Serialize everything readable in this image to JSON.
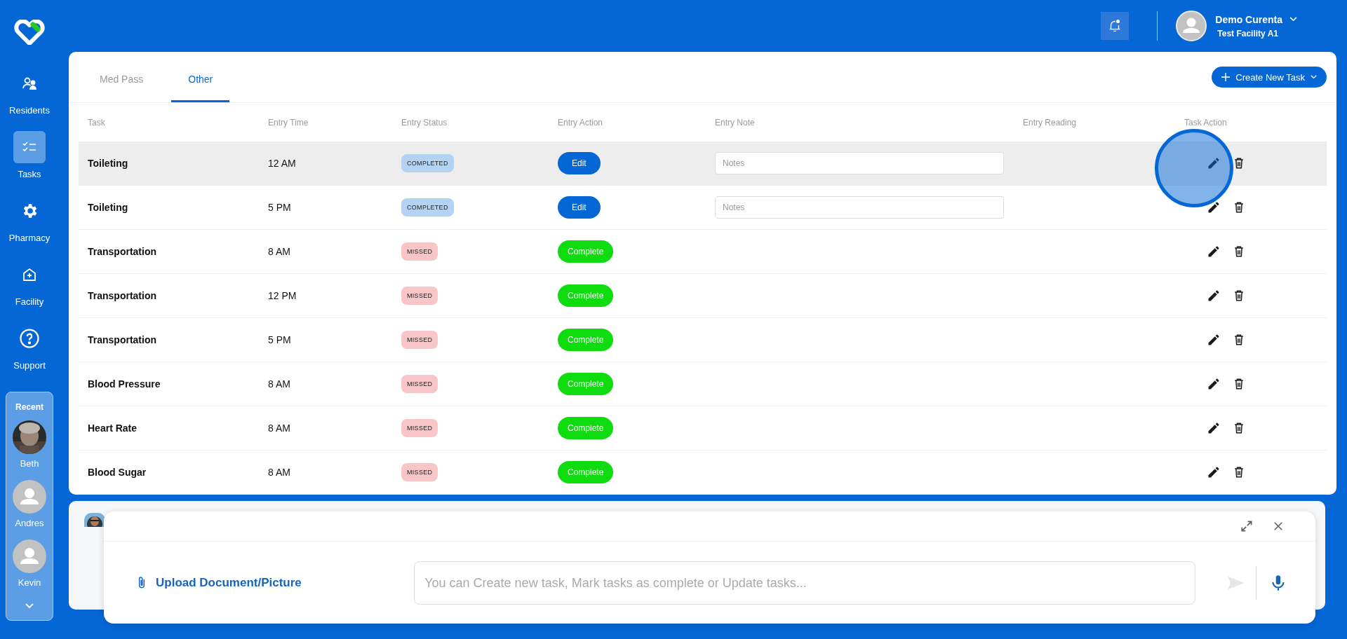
{
  "sidebar": {
    "items": [
      {
        "label": "Residents",
        "selected": false
      },
      {
        "label": "Tasks",
        "selected": true
      },
      {
        "label": "Pharmacy",
        "selected": false
      },
      {
        "label": "Facility",
        "selected": false
      },
      {
        "label": "Support",
        "selected": false
      }
    ],
    "recent": {
      "title": "Recent",
      "people": [
        {
          "name": "Beth",
          "kind": "picture"
        },
        {
          "name": "Andres",
          "kind": "default"
        },
        {
          "name": "Kevin",
          "kind": "default"
        }
      ]
    }
  },
  "header": {
    "user_name": "Demo Curenta",
    "facility": "Test Facility A1"
  },
  "tabs": [
    {
      "label": "Med Pass",
      "selected": false
    },
    {
      "label": "Other",
      "selected": true
    }
  ],
  "create_button": "Create New Task",
  "table": {
    "columns": [
      "Task",
      "Entry Time",
      "Entry Status",
      "Entry Action",
      "Entry Note",
      "Entry Reading",
      "Task Action"
    ],
    "rows": [
      {
        "task": "Toileting",
        "time": "12 AM",
        "status": "COMPLETED",
        "kind": "completed",
        "action": "Edit",
        "note_placeholder": "Notes",
        "selected": true
      },
      {
        "task": "Toileting",
        "time": "5 PM",
        "status": "COMPLETED",
        "kind": "completed",
        "action": "Edit",
        "note_placeholder": "Notes",
        "selected": false
      },
      {
        "task": "Transportation",
        "time": "8 AM",
        "status": "MISSED",
        "kind": "missed",
        "action": "Complete",
        "selected": false
      },
      {
        "task": "Transportation",
        "time": "12 PM",
        "status": "MISSED",
        "kind": "missed",
        "action": "Complete",
        "selected": false
      },
      {
        "task": "Transportation",
        "time": "5 PM",
        "status": "MISSED",
        "kind": "missed",
        "action": "Complete",
        "selected": false
      },
      {
        "task": "Blood Pressure",
        "time": "8 AM",
        "status": "MISSED",
        "kind": "missed",
        "action": "Complete",
        "selected": false
      },
      {
        "task": "Heart Rate",
        "time": "8 AM",
        "status": "MISSED",
        "kind": "missed",
        "action": "Complete",
        "selected": false
      },
      {
        "task": "Blood Sugar",
        "time": "8 AM",
        "status": "MISSED",
        "kind": "missed",
        "action": "Complete",
        "selected": false
      }
    ]
  },
  "assistant": {
    "upload_label": "Upload Document/Picture",
    "input_placeholder": "You can Create new task, Mark tasks as complete or Update tasks..."
  }
}
